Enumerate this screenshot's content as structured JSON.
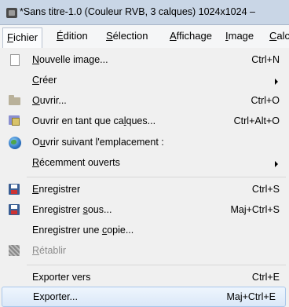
{
  "window": {
    "title": "*Sans titre-1.0 (Couleur RVB, 3 calques) 1024x1024 –"
  },
  "menubar": {
    "items": [
      {
        "pre": "",
        "u": "F",
        "post": "ichier"
      },
      {
        "pre": "",
        "u": "É",
        "post": "dition"
      },
      {
        "pre": "",
        "u": "S",
        "post": "élection"
      },
      {
        "pre": "",
        "u": "A",
        "post": "ffichage"
      },
      {
        "pre": "",
        "u": "I",
        "post": "mage"
      },
      {
        "pre": "",
        "u": "C",
        "post": "alc"
      }
    ]
  },
  "menu": {
    "items": [
      {
        "pre": "",
        "u": "N",
        "post": "ouvelle image...",
        "shortcut": "Ctrl+N",
        "icon": "new-image-icon"
      },
      {
        "pre": "",
        "u": "C",
        "post": "réer",
        "shortcut": "",
        "icon": ""
      },
      {
        "pre": "",
        "u": "O",
        "post": "uvrir...",
        "shortcut": "Ctrl+O",
        "icon": "folder-icon"
      },
      {
        "pre": "Ouvrir en tant que ca",
        "u": "l",
        "post": "ques...",
        "shortcut": "Ctrl+Alt+O",
        "icon": "layers-icon"
      },
      {
        "pre": "O",
        "u": "u",
        "post": "vrir suivant l'emplacement :",
        "shortcut": "",
        "icon": "globe-icon"
      },
      {
        "pre": "",
        "u": "R",
        "post": "écemment ouverts",
        "shortcut": "",
        "icon": ""
      },
      {
        "pre": "",
        "u": "E",
        "post": "nregistrer",
        "shortcut": "Ctrl+S",
        "icon": "save-icon"
      },
      {
        "pre": "Enregistrer ",
        "u": "s",
        "post": "ous...",
        "shortcut": "Maj+Ctrl+S",
        "icon": "save-as-icon"
      },
      {
        "pre": "Enregistrer une ",
        "u": "c",
        "post": "opie...",
        "shortcut": "",
        "icon": ""
      },
      {
        "pre": "",
        "u": "R",
        "post": "établir",
        "shortcut": "",
        "icon": "revert-icon"
      },
      {
        "pre": "Exporter vers",
        "u": "",
        "post": "",
        "shortcut": "Ctrl+E",
        "icon": ""
      },
      {
        "pre": "Exporter...",
        "u": "",
        "post": "",
        "shortcut": "Maj+Ctrl+E",
        "icon": ""
      }
    ]
  }
}
